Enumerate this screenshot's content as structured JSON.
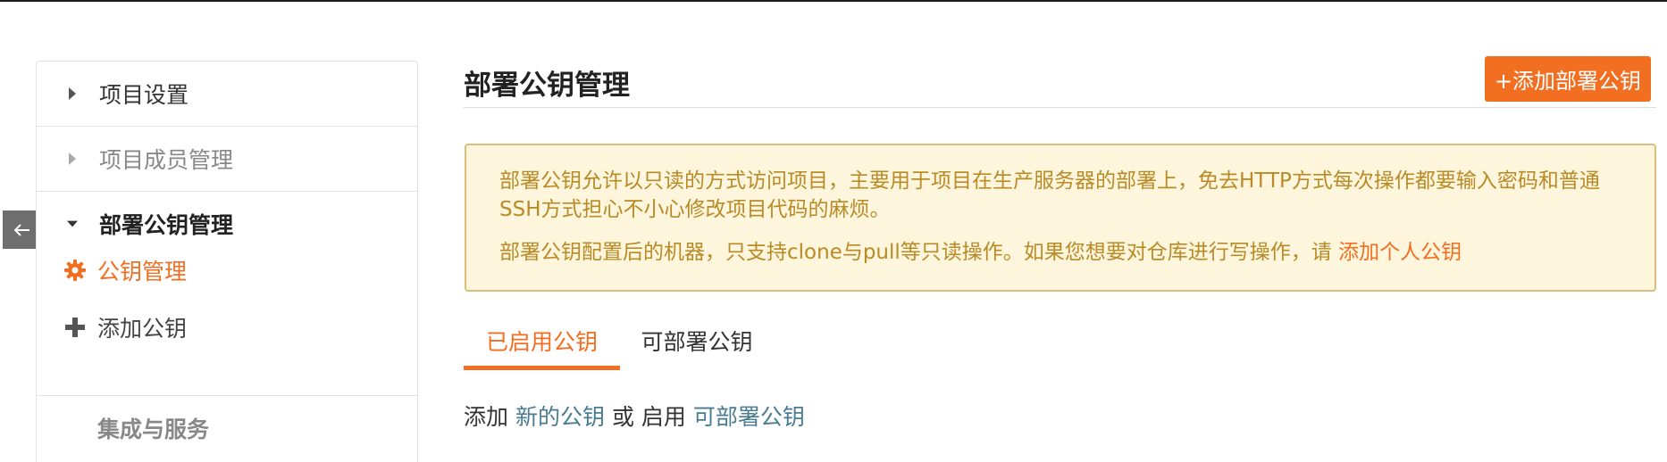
{
  "sidebar": {
    "items": [
      {
        "label": "项目设置",
        "expanded": false
      },
      {
        "label": "项目成员管理",
        "expanded": false
      },
      {
        "label": "部署公钥管理",
        "expanded": true
      }
    ],
    "sub_items": [
      {
        "label": "公钥管理",
        "icon": "gear-icon",
        "active": true
      },
      {
        "label": "添加公钥",
        "icon": "plus-icon",
        "active": false
      }
    ],
    "bottom_item": {
      "label": "集成与服务"
    }
  },
  "header": {
    "title": "部署公钥管理",
    "add_button": "+添加部署公钥"
  },
  "notice": {
    "line1": "部署公钥允许以只读的方式访问项目，主要用于项目在生产服务器的部署上，免去HTTP方式每次操作都要输入密码和普通SSH方式担心不小心修改项目代码的麻烦。",
    "line2_text": "部署公钥配置后的机器，只支持clone与pull等只读操作。如果您想要对仓库进行写操作，请",
    "line2_link": "添加个人公钥"
  },
  "tabs": [
    {
      "label": "已启用公钥",
      "active": true
    },
    {
      "label": "可部署公钥",
      "active": false
    }
  ],
  "hint": {
    "prefix": "添加",
    "link1": "新的公钥",
    "middle": "或 启用",
    "link2": "可部署公钥"
  },
  "colors": {
    "accent": "#f26f21",
    "notice_bg": "#fdf6dc",
    "notice_text": "#b98a26",
    "link": "#4a7c91"
  }
}
